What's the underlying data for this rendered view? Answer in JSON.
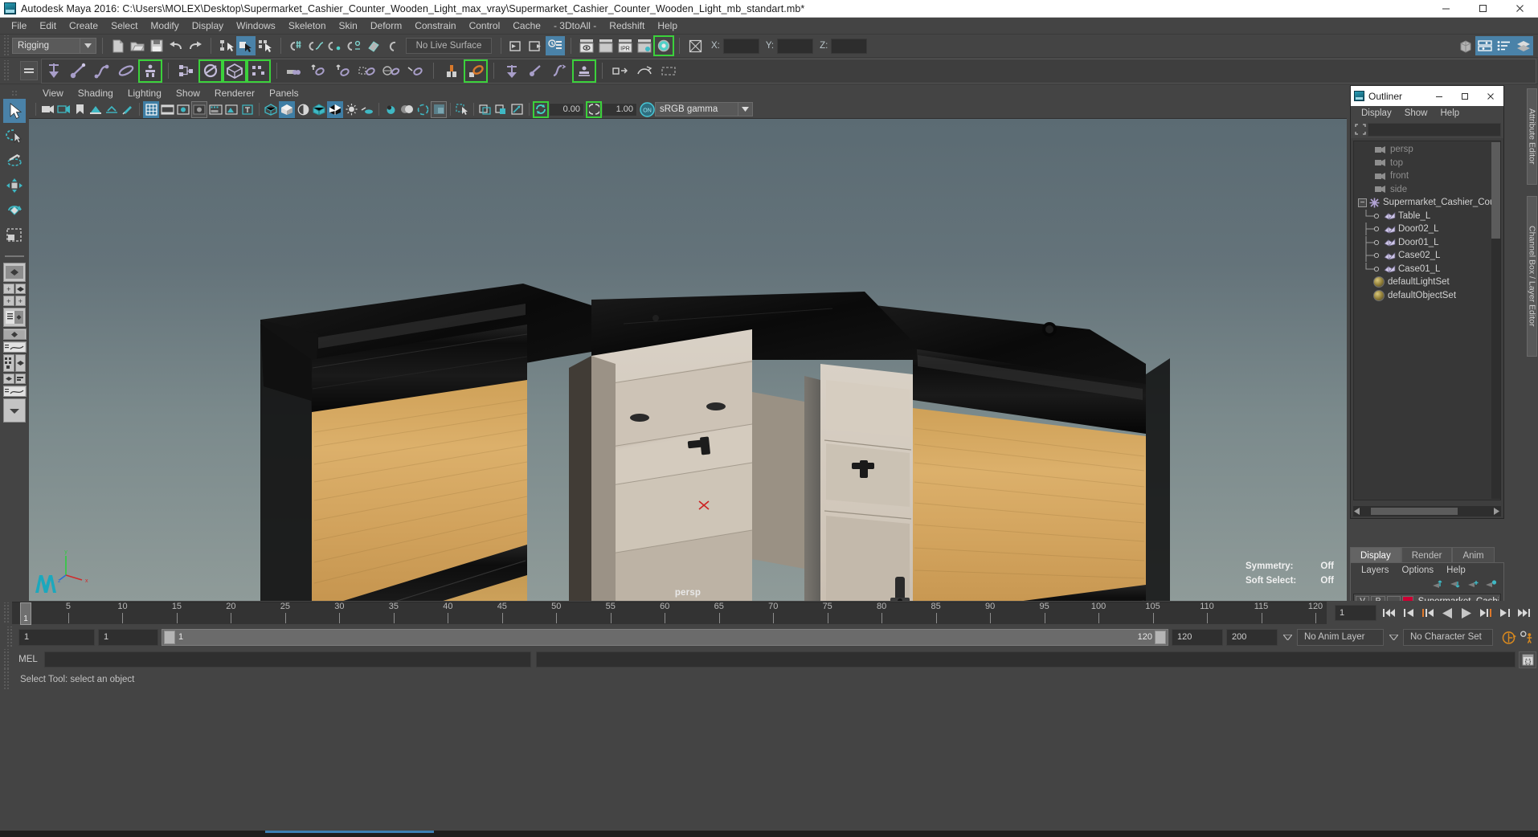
{
  "window": {
    "title": "Autodesk Maya 2016: C:\\Users\\MOLEX\\Desktop\\Supermarket_Cashier_Counter_Wooden_Light_max_vray\\Supermarket_Cashier_Counter_Wooden_Light_mb_standart.mb*",
    "icon": "maya-app-icon",
    "minimize": "—",
    "maximize": "☐",
    "close": "✕"
  },
  "menubar": {
    "items": [
      "File",
      "Edit",
      "Create",
      "Select",
      "Modify",
      "Display",
      "Windows",
      "Skeleton",
      "Skin",
      "Deform",
      "Constrain",
      "Control",
      "Cache",
      "- 3DtoAll -",
      "Redshift",
      "Help"
    ]
  },
  "statusline": {
    "menuset": "Rigging",
    "menuset_arrow": "▼",
    "live_surface": "No Live Surface",
    "axis_labels": {
      "x": "X:",
      "y": "Y:",
      "z": "Z:"
    },
    "axis_values": {
      "x": "",
      "y": "",
      "z": ""
    },
    "icons": [
      "new-scene-icon",
      "open-scene-icon",
      "save-scene-icon",
      "undo-icon",
      "redo-icon",
      "select-by-hierarchy-icon",
      "select-by-object-icon",
      "select-by-component-icon",
      "snap-to-grid-icon",
      "snap-to-curve-icon",
      "snap-to-point-icon",
      "snap-to-projected-center-icon",
      "snap-to-view-plane-icon",
      "make-live-icon",
      "input-connections-icon",
      "output-connections-icon",
      "construction-history-icon",
      "render-current-frame-icon",
      "render-sequence-icon",
      "ipr-render-icon",
      "render-settings-icon",
      "hypershade-icon",
      "toggle-editor-icon"
    ],
    "right_icons": [
      "show-hide-modeling-toolkit-icon",
      "attribute-editor-icon",
      "channel-box-icon",
      "layer-editor-icon"
    ]
  },
  "shelf": {
    "tab_button": "shelf-tab-menu-icon",
    "icons": [
      "create-joint-icon",
      "create-ik-handle-icon",
      "create-ik-spline-icon",
      "insert-joint-icon",
      "quick-rig-icon",
      "hik-skeleton-icon",
      "hik-control-rig-icon",
      "humanik-icon",
      "skeleton-generator-icon",
      "pose-deformer-icon",
      "bind-skin-icon",
      "interactive-bind-icon",
      "detach-skin-icon",
      "paint-skin-weights-icon",
      "mirror-skin-weights-icon",
      "copy-skin-weights-icon",
      "constraint-parent-icon",
      "constraint-point-icon",
      "lattice-icon",
      "cluster-icon",
      "wire-tool-icon",
      "soft-modification-icon",
      "blend-shape-icon",
      "nonlinear-deformer-icon"
    ]
  },
  "toolbox": {
    "tools": [
      "select-tool",
      "lasso-select-tool",
      "paint-select-tool",
      "move-tool",
      "rotate-tool",
      "scale-tool"
    ],
    "selected_tool": "select-tool",
    "layouts": [
      "single-perspective-layout",
      "four-view-layout",
      "outliner-persp-layout",
      "persp-graph-editor-layout",
      "hypershade-persp-layout",
      "persp-trax-layout",
      "layout-more-icon"
    ]
  },
  "viewport": {
    "panel_menu": [
      "View",
      "Shading",
      "Lighting",
      "Show",
      "Renderer",
      "Panels"
    ],
    "toolbar_icons": [
      "select-camera-icon",
      "camera-attributes-icon",
      "bookmark-icon",
      "image-plane-icon",
      "two-sided-lighting-icon",
      "grease-pencil-icon",
      "grid-icon",
      "film-gate-icon",
      "resolution-gate-icon",
      "gate-mask-icon",
      "film-origin-icon",
      "exposure-icon",
      "hud-text-icon",
      "wireframe-icon",
      "smooth-shade-icon",
      "smooth-shade-all-icon",
      "shaded-wireframe-icon",
      "textured-icon",
      "use-lights-icon",
      "shadows-icon",
      "screen-space-ao-icon",
      "motion-blur-icon",
      "multisample-aa-icon",
      "depth-of-field-icon",
      "isolate-select-icon",
      "xray-icon",
      "xray-joints-icon",
      "xray-active-components-icon",
      "exposure-toggle-icon",
      "gamma-toggle-icon",
      "color-management-on-icon"
    ],
    "exposure_value": "0.00",
    "gamma_value": "1.00",
    "color_profile": "sRGB gamma",
    "color_profile_arrow": "▼",
    "camera_label": "persp",
    "hud": [
      {
        "label": "Symmetry:",
        "value": "Off"
      },
      {
        "label": "Soft Select:",
        "value": "Off"
      }
    ],
    "axis_labels": {
      "x": "x",
      "y": "y",
      "z": "z"
    }
  },
  "outliner": {
    "window_title": "Outliner",
    "window_icon": "maya-app-icon",
    "minimize": "—",
    "maximize": "☐",
    "close": "✕",
    "menu": [
      "Display",
      "Show",
      "Help"
    ],
    "search_icon": "search-filter-icon",
    "search_value": "",
    "search_placeholder": "",
    "tree": [
      {
        "label": "persp",
        "type": "camera",
        "depth": 1,
        "dim": true
      },
      {
        "label": "top",
        "type": "camera",
        "depth": 1,
        "dim": true
      },
      {
        "label": "front",
        "type": "camera",
        "depth": 1,
        "dim": true
      },
      {
        "label": "side",
        "type": "camera",
        "depth": 1,
        "dim": true
      },
      {
        "label": "Supermarket_Cashier_Cou",
        "type": "group",
        "depth": 0,
        "expanded": true,
        "expand_glyph": "−"
      },
      {
        "label": "Table_L",
        "type": "mesh",
        "depth": 2
      },
      {
        "label": "Door02_L",
        "type": "mesh",
        "depth": 2
      },
      {
        "label": "Door01_L",
        "type": "mesh",
        "depth": 2
      },
      {
        "label": "Case02_L",
        "type": "mesh",
        "depth": 2
      },
      {
        "label": "Case01_L",
        "type": "mesh",
        "depth": 2
      },
      {
        "label": "defaultLightSet",
        "type": "set",
        "depth": 1
      },
      {
        "label": "defaultObjectSet",
        "type": "set",
        "depth": 1
      }
    ]
  },
  "channelbox": {
    "tabs": [
      "Display",
      "Render",
      "Anim"
    ],
    "selected_tab": "Display",
    "menu": [
      "Layers",
      "Options",
      "Help"
    ],
    "toolbar_icons": [
      "move-layer-up-icon",
      "move-layer-down-icon",
      "new-layer-icon",
      "new-layer-from-selected-icon"
    ],
    "layers": [
      {
        "visibility": "V",
        "playback": "P",
        "display_type": "",
        "color": "#cc0033",
        "name": "Supermarket_Cashier_"
      }
    ]
  },
  "right_tabs": [
    "Attribute Editor",
    "Channel Box / Layer Editor"
  ],
  "timeline": {
    "start": 1,
    "end": 120,
    "current_frame": "1",
    "ticks": [
      5,
      10,
      15,
      20,
      25,
      30,
      35,
      40,
      45,
      50,
      55,
      60,
      65,
      70,
      75,
      80,
      85,
      90,
      95,
      100,
      105,
      110,
      115,
      120
    ],
    "cursor_label": "1",
    "playback_icons": [
      "go-to-start-icon",
      "step-back-keyframe-icon",
      "step-back-frame-icon",
      "play-backwards-icon",
      "play-forwards-icon",
      "step-forward-frame-icon",
      "step-forward-keyframe-icon",
      "go-to-end-icon"
    ],
    "range_start": "1",
    "range_start2": "1",
    "range_slider_min": "1",
    "range_slider_max": "120",
    "range_end": "120",
    "playback_end": "200",
    "anim_layer": "No Anim Layer",
    "character_set": "No Character Set",
    "anim_layer_arrow": "▽",
    "character_set_arrow": "▽",
    "auto_key_icon": "auto-keyframe-icon",
    "anim_prefs_icon": "animation-preferences-icon"
  },
  "command_line": {
    "label": "MEL",
    "value": "",
    "placeholder": "",
    "script_editor_icon": "script-editor-icon"
  },
  "status_bar": {
    "message": "Select Tool: select an object"
  },
  "colors": {
    "accent_blue": "#4a82a8",
    "highlight_green": "#3bd13b",
    "chrome_bg": "#444444",
    "panel_bg": "#3e3e3e",
    "layer_color": "#cc0033",
    "orange": "#e0792b",
    "teal": "#3fb8c4"
  }
}
